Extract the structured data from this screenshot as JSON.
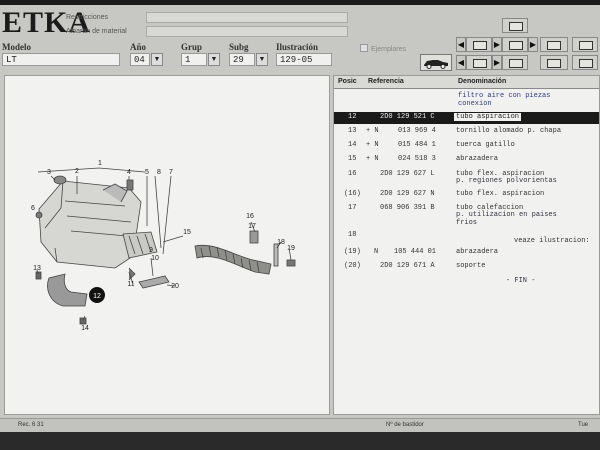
{
  "app": {
    "logo": "ETKA",
    "restricciones_label": "Restricciones",
    "albaran_label": "Albarán de material",
    "ejemplares_label": "Ejemplares"
  },
  "fields": {
    "modelo": {
      "label": "Modelo",
      "value": "LT"
    },
    "ano": {
      "label": "Año",
      "value": "04"
    },
    "grup": {
      "label": "Grup",
      "value": "1"
    },
    "subg": {
      "label": "Subg",
      "value": "29"
    },
    "ilustracion": {
      "label": "Ilustración",
      "value": "129-05"
    }
  },
  "table": {
    "headers": {
      "posic": "Posic",
      "referencia": "Referencia",
      "denominacion": "Denominación"
    },
    "group_title": [
      "filtro aire con piezas",
      "conexion"
    ],
    "rows": [
      {
        "pos": "12",
        "flag": "",
        "ref": "2D0 129 521 C",
        "den": "tubo aspiracion",
        "selected": true
      },
      {
        "pos": "13",
        "flag": "+ N",
        "ref": "013 969 4",
        "den": "tornillo alomado p. chapa",
        "selected": false
      },
      {
        "pos": "14",
        "flag": "+ N",
        "ref": "015 484 1",
        "den": "tuerca gatillo",
        "selected": false
      },
      {
        "pos": "15",
        "flag": "+ N",
        "ref": "024 518 3",
        "den": "abrazadera",
        "selected": false
      },
      {
        "pos": "16",
        "flag": "",
        "ref": "2D0 129 627 L",
        "den": "tubo flex. aspiracion",
        "den2": "p. regiones polvorientas",
        "selected": false
      },
      {
        "pos": "(16)",
        "flag": "",
        "ref": "2D0 129 627 N",
        "den": "tubo flex. aspiracion",
        "selected": false
      },
      {
        "pos": "17",
        "flag": "",
        "ref": "068 906 391 B",
        "den": "tubo calefaccion",
        "den2": "p. utilizacion en paises",
        "den3": "frios",
        "selected": false
      },
      {
        "pos": "18",
        "flag": "",
        "ref": "",
        "den": "veaze ilustracion:",
        "selected": false
      },
      {
        "pos": "(19)",
        "flag": "N",
        "ref": "105 444 01",
        "den": "abrazadera",
        "selected": false
      },
      {
        "pos": "(20)",
        "flag": "",
        "ref": "2D0 129 671 A",
        "den": "soporte",
        "selected": false
      }
    ],
    "fin": "- FIN -"
  },
  "drawing": {
    "callouts": [
      "1",
      "2",
      "3",
      "4",
      "5",
      "6",
      "7",
      "8",
      "9",
      "10",
      "11",
      "12",
      "13",
      "14",
      "15",
      "16",
      "17",
      "18",
      "19",
      "20"
    ]
  },
  "status": {
    "left": "Rec. 6 31",
    "center": "Nº de bastidor",
    "right": "Tue"
  }
}
